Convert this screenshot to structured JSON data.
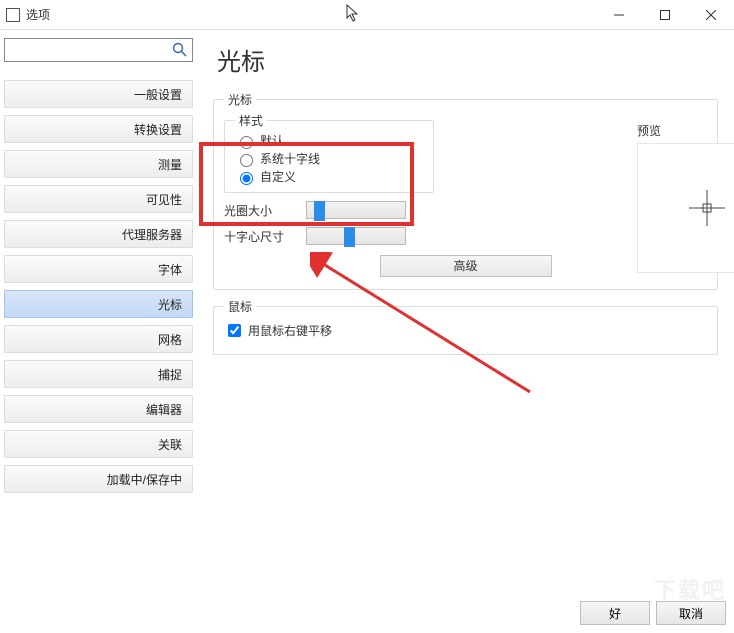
{
  "window": {
    "title": "选项"
  },
  "search": {
    "placeholder": ""
  },
  "sidebar": {
    "items": [
      {
        "label": "一般设置"
      },
      {
        "label": "转换设置"
      },
      {
        "label": "测量"
      },
      {
        "label": "可见性"
      },
      {
        "label": "代理服务器"
      },
      {
        "label": "字体"
      },
      {
        "label": "光标"
      },
      {
        "label": "网格"
      },
      {
        "label": "捕捉"
      },
      {
        "label": "编辑器"
      },
      {
        "label": "关联"
      },
      {
        "label": "加载中/保存中"
      }
    ],
    "selected_index": 6
  },
  "page": {
    "title": "光标",
    "cursor_group": "光标",
    "style_group": "样式",
    "radio_default": "默认",
    "radio_system_cross": "系统十字线",
    "radio_custom": "自定义",
    "selected_style": "custom",
    "aperture_label": "光圈大小",
    "cross_size_label": "十字心尺寸",
    "aperture_value": 8,
    "cross_size_value": 42,
    "preview_label": "预览",
    "advanced_button": "高级",
    "mouse_group": "鼠标",
    "mouse_checkbox": "用鼠标右键平移",
    "mouse_checked": true
  },
  "footer": {
    "ok": "好",
    "cancel": "取消"
  },
  "watermark": "下载吧"
}
